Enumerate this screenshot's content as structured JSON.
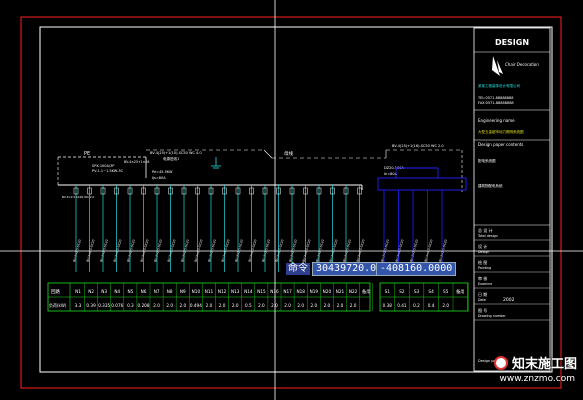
{
  "title_block": {
    "brand": "DESIGN",
    "company_logo_text": "Chair Decoration",
    "company_name": "某某工程装饰设计有限公司",
    "tel": "TEL:0571-88888888",
    "fax": "FAX:0571-88888888",
    "engineering_name_label": "Engineering name",
    "project_name": "大型五金超市动力照明系统图",
    "drawing_content_label": "Design paper contents",
    "drawing_content": "配电系统图",
    "sub_content": "建筑物配电系统",
    "fields": [
      {
        "cn": "总 设 计",
        "en": "Total design"
      },
      {
        "cn": "设 计",
        "en": "Design"
      },
      {
        "cn": "绘 图",
        "en": "Painting"
      },
      {
        "cn": "审 核",
        "en": "Examine"
      },
      {
        "cn": "日 期",
        "en": "Date"
      },
      {
        "cn": "图 号",
        "en": "Drawing number"
      }
    ],
    "date_value": "2002",
    "page_label": "Design paper NO."
  },
  "diagram": {
    "pe_label": "PE",
    "main_cb_left": "SPX-100A/3P",
    "main_cb_left_2": "PV-1.1~1.5KW-3C",
    "mid_text_1": "BV-4(25)+1(10)-SC50 WC 4.0",
    "mid_text_2": "电源进线1",
    "power_1": "Pe=45.5KW",
    "power_2": "Ijs=80A",
    "cable_left": "BV-4×25+1×16",
    "bus_label": "母线",
    "right_text_1": "BV-4(25)+1(16)-SC50 WC 2.0",
    "right_cb": "DZ20-100A",
    "right_cb_2": "In=80A",
    "circuit_label": "BV-3×2.5 SC20 WC 2.0",
    "bottom_circuits": [
      "S1",
      "S2",
      "S3",
      "S4",
      "S5"
    ],
    "table_rows": {
      "header_left": "回路",
      "header_right": "回路",
      "load_label": "负荷(kW)"
    },
    "n_cols": [
      "N1",
      "N2",
      "N3",
      "N4",
      "N5",
      "N6",
      "N7",
      "N8",
      "N9",
      "N10",
      "N11",
      "N12",
      "N13",
      "N14",
      "N15",
      "N16",
      "N17",
      "N18",
      "N19",
      "N20",
      "N21",
      "N22",
      "备用"
    ],
    "n_vals": [
      "3.3",
      "0.39",
      "0.335",
      "0.076",
      "0.3",
      "0.208",
      "2.0",
      "2.0",
      "2.0",
      "0.494",
      "2.0",
      "2.0",
      "2.0",
      "0.5",
      "2.0",
      "2.0",
      "2.0",
      "2.0",
      "2.0",
      "2.0",
      "2.0",
      "2.0",
      ""
    ],
    "s_cols": [
      "S1",
      "S2",
      "S3",
      "S4",
      "S5",
      "备用"
    ],
    "s_vals": [
      "0.38",
      "0.41",
      "0.2",
      "0.4",
      "2.0",
      ""
    ]
  },
  "command": {
    "label": "命令",
    "x": "30439720.0000",
    "y": "-408160.0000"
  },
  "watermark": {
    "name": "知末施工图",
    "url": "www.znzmo.com"
  },
  "colors": {
    "background": "#000000",
    "frame_red": "#ff2020",
    "cyan": "#20e0e0",
    "blue": "#2020ff",
    "white": "#ffffff",
    "green": "#20e020",
    "yellow": "#e0e020"
  }
}
